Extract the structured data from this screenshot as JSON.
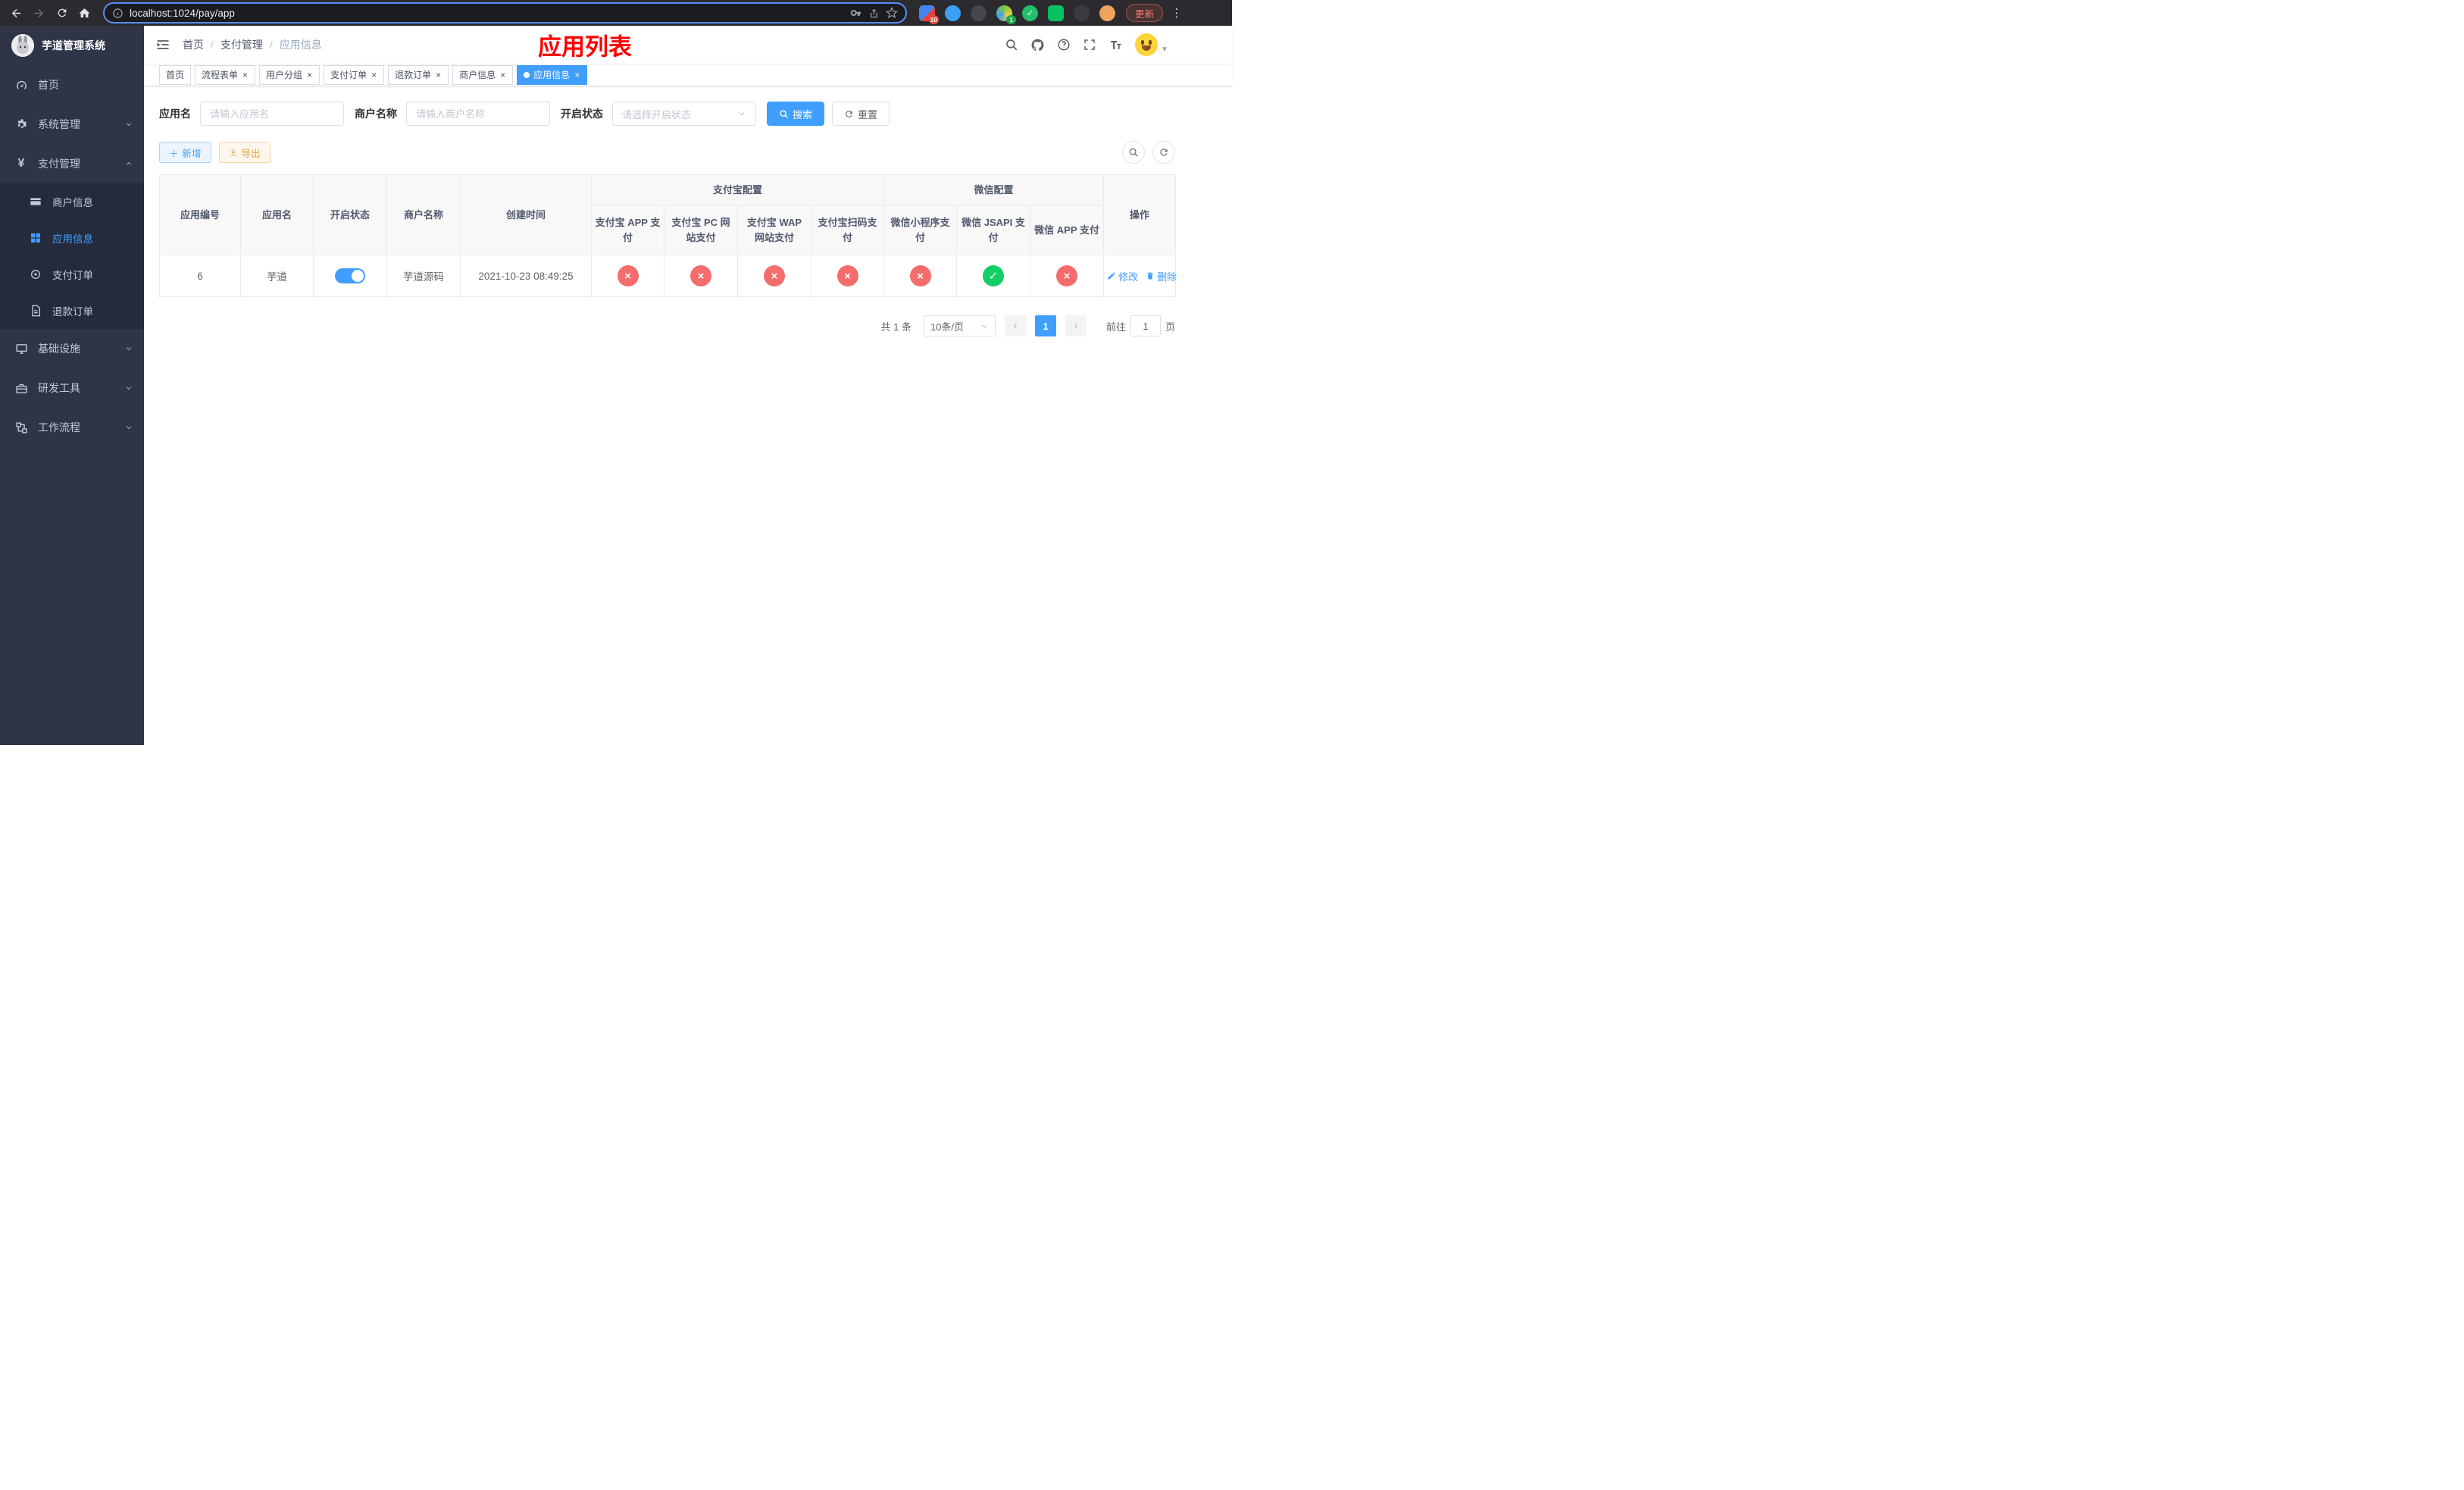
{
  "browser": {
    "url": "localhost:1024/pay/app",
    "update_label": "更新",
    "extension_badge_1": "10",
    "extension_badge_2": "1"
  },
  "sidebar": {
    "logo_title": "芋道管理系统",
    "active_item": "应用信息",
    "menu": [
      {
        "label": "首页"
      },
      {
        "label": "系统管理"
      },
      {
        "label": "支付管理",
        "children": [
          {
            "label": "商户信息"
          },
          {
            "label": "应用信息"
          },
          {
            "label": "支付订单"
          },
          {
            "label": "退款订单"
          }
        ]
      },
      {
        "label": "基础设施"
      },
      {
        "label": "研发工具"
      },
      {
        "label": "工作流程"
      }
    ]
  },
  "navbar": {
    "breadcrumb": [
      "首页",
      "支付管理",
      "应用信息"
    ],
    "page_title": "应用列表"
  },
  "tabs": [
    {
      "label": "首页",
      "closable": false,
      "active": false
    },
    {
      "label": "流程表单",
      "closable": true,
      "active": false
    },
    {
      "label": "用户分组",
      "closable": true,
      "active": false
    },
    {
      "label": "支付订单",
      "closable": true,
      "active": false
    },
    {
      "label": "退款订单",
      "closable": true,
      "active": false
    },
    {
      "label": "商户信息",
      "closable": true,
      "active": false
    },
    {
      "label": "应用信息",
      "closable": true,
      "active": true
    }
  ],
  "filters": {
    "app_name_label": "应用名",
    "app_name_placeholder": "请输入应用名",
    "merchant_label": "商户名称",
    "merchant_placeholder": "请输入商户名称",
    "status_label": "开启状态",
    "status_placeholder": "请选择开启状态",
    "search_label": "搜索",
    "reset_label": "重置"
  },
  "toolbar": {
    "add_label": "新增",
    "export_label": "导出"
  },
  "table": {
    "headers": {
      "app_id": "应用编号",
      "app_name": "应用名",
      "status": "开启状态",
      "merchant": "商户名称",
      "create_time": "创建时间",
      "alipay_group": "支付宝配置",
      "alipay_app": "支付宝 APP 支付",
      "alipay_pc": "支付宝 PC 网站支付",
      "alipay_wap": "支付宝 WAP 网站支付",
      "alipay_qr": "支付宝扫码支付",
      "wechat_group": "微信配置",
      "wechat_mini": "微信小程序支付",
      "wechat_jsapi": "微信 JSAPI 支付",
      "wechat_app": "微信 APP 支付",
      "actions": "操作"
    },
    "row_actions": {
      "edit": "修改",
      "delete": "删除"
    },
    "rows": [
      {
        "app_id": "6",
        "app_name": "芋道",
        "status_on": true,
        "merchant": "芋道源码",
        "create_time": "2021-10-23 08:49:25",
        "alipay_app": "fail",
        "alipay_pc": "fail",
        "alipay_wap": "fail",
        "alipay_qr": "fail",
        "wechat_mini": "fail",
        "wechat_jsapi": "success",
        "wechat_app": "fail"
      }
    ]
  },
  "pagination": {
    "total_text": "共 1 条",
    "page_size": "10条/页",
    "current_page": "1",
    "goto_prefix": "前往",
    "goto_value": "1",
    "goto_suffix": "页"
  },
  "colors": {
    "primary": "#409eff",
    "success": "#13ce66",
    "danger": "#f56c6c",
    "warning": "#e6a23c",
    "page_title_red": "#ff0000",
    "sidebar_bg": "#2f3447",
    "submenu_bg": "#242b3d"
  },
  "icons": {
    "browser": [
      "back-icon",
      "forward-icon",
      "reload-icon",
      "home-icon",
      "info-icon",
      "key-icon",
      "share-icon",
      "star-icon",
      "kebab-menu-icon"
    ],
    "navbar_right": [
      "search-icon",
      "github-icon",
      "help-icon",
      "fullscreen-icon",
      "font-size-icon",
      "user-avatar",
      "caret-down-icon"
    ],
    "sidebar": [
      "dashboard-icon",
      "gear-icon",
      "yen-icon",
      "creditcard-icon",
      "grid-icon",
      "circle-dot-icon",
      "document-icon",
      "monitor-icon",
      "toolbox-icon",
      "workflow-icon"
    ]
  }
}
